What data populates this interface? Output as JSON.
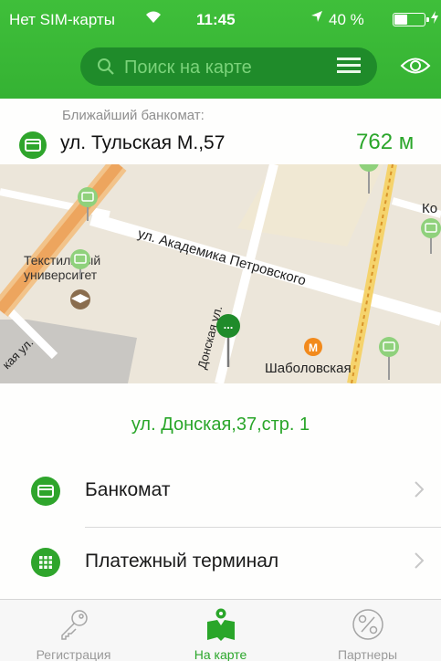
{
  "status_bar": {
    "carrier": "Нет SIM-карты",
    "time": "11:45",
    "battery": "40 %",
    "battery_level": 0.4
  },
  "search": {
    "placeholder": "Поиск на карте"
  },
  "nearest": {
    "label": "Ближайший банкомат:",
    "address": "ул. Тульская М.,57",
    "distance": "762 м"
  },
  "map": {
    "street_1": "ул. Академика Петровского",
    "street_2": "Донская ул.",
    "street_3": "кая ул.",
    "poi_university_line1": "Текстильный",
    "poi_university_line2": "университет",
    "metro_station": "Шаболовская",
    "metro_letter": "М",
    "edge_label": "Ко",
    "pin_dots": "..."
  },
  "panel": {
    "selected_address": "ул. Донская,37,стр. 1",
    "items": [
      {
        "label": "Банкомат",
        "icon": "atm-card-icon"
      },
      {
        "label": "Платежный терминал",
        "icon": "terminal-grid-icon"
      }
    ]
  },
  "tabbar": {
    "tabs": [
      {
        "label": "Регистрация",
        "icon": "key-icon",
        "active": false
      },
      {
        "label": "На карте",
        "icon": "map-person-icon",
        "active": true
      },
      {
        "label": "Партнеры",
        "icon": "percent-icon",
        "active": false
      }
    ]
  },
  "colors": {
    "brand_green": "#35b233",
    "dark_green": "#1f8b2a",
    "accent_text": "#2aa62a",
    "metro_orange": "#f28a1c"
  }
}
